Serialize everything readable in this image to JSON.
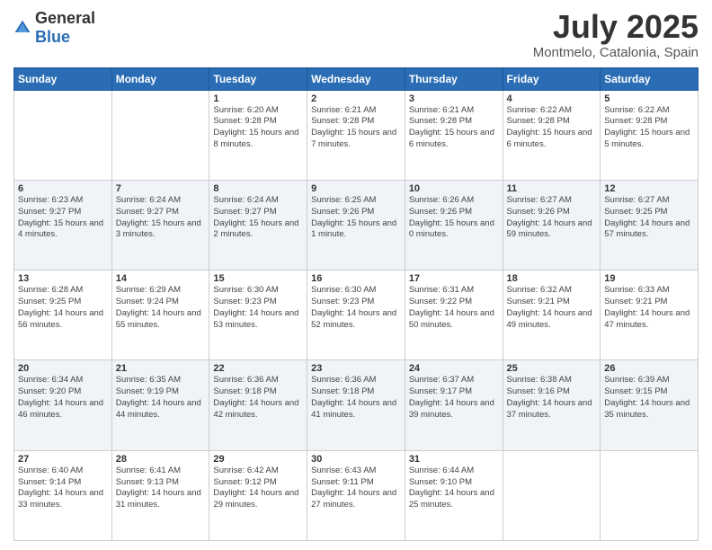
{
  "logo": {
    "general": "General",
    "blue": "Blue"
  },
  "title": {
    "month_year": "July 2025",
    "location": "Montmelo, Catalonia, Spain"
  },
  "weekdays": [
    "Sunday",
    "Monday",
    "Tuesday",
    "Wednesday",
    "Thursday",
    "Friday",
    "Saturday"
  ],
  "weeks": [
    [
      null,
      null,
      {
        "day": 1,
        "sunrise": "6:20 AM",
        "sunset": "9:28 PM",
        "daylight": "15 hours and 8 minutes."
      },
      {
        "day": 2,
        "sunrise": "6:21 AM",
        "sunset": "9:28 PM",
        "daylight": "15 hours and 7 minutes."
      },
      {
        "day": 3,
        "sunrise": "6:21 AM",
        "sunset": "9:28 PM",
        "daylight": "15 hours and 6 minutes."
      },
      {
        "day": 4,
        "sunrise": "6:22 AM",
        "sunset": "9:28 PM",
        "daylight": "15 hours and 6 minutes."
      },
      {
        "day": 5,
        "sunrise": "6:22 AM",
        "sunset": "9:28 PM",
        "daylight": "15 hours and 5 minutes."
      }
    ],
    [
      {
        "day": 6,
        "sunrise": "6:23 AM",
        "sunset": "9:27 PM",
        "daylight": "15 hours and 4 minutes."
      },
      {
        "day": 7,
        "sunrise": "6:24 AM",
        "sunset": "9:27 PM",
        "daylight": "15 hours and 3 minutes."
      },
      {
        "day": 8,
        "sunrise": "6:24 AM",
        "sunset": "9:27 PM",
        "daylight": "15 hours and 2 minutes."
      },
      {
        "day": 9,
        "sunrise": "6:25 AM",
        "sunset": "9:26 PM",
        "daylight": "15 hours and 1 minute."
      },
      {
        "day": 10,
        "sunrise": "6:26 AM",
        "sunset": "9:26 PM",
        "daylight": "15 hours and 0 minutes."
      },
      {
        "day": 11,
        "sunrise": "6:27 AM",
        "sunset": "9:26 PM",
        "daylight": "14 hours and 59 minutes."
      },
      {
        "day": 12,
        "sunrise": "6:27 AM",
        "sunset": "9:25 PM",
        "daylight": "14 hours and 57 minutes."
      }
    ],
    [
      {
        "day": 13,
        "sunrise": "6:28 AM",
        "sunset": "9:25 PM",
        "daylight": "14 hours and 56 minutes."
      },
      {
        "day": 14,
        "sunrise": "6:29 AM",
        "sunset": "9:24 PM",
        "daylight": "14 hours and 55 minutes."
      },
      {
        "day": 15,
        "sunrise": "6:30 AM",
        "sunset": "9:23 PM",
        "daylight": "14 hours and 53 minutes."
      },
      {
        "day": 16,
        "sunrise": "6:30 AM",
        "sunset": "9:23 PM",
        "daylight": "14 hours and 52 minutes."
      },
      {
        "day": 17,
        "sunrise": "6:31 AM",
        "sunset": "9:22 PM",
        "daylight": "14 hours and 50 minutes."
      },
      {
        "day": 18,
        "sunrise": "6:32 AM",
        "sunset": "9:21 PM",
        "daylight": "14 hours and 49 minutes."
      },
      {
        "day": 19,
        "sunrise": "6:33 AM",
        "sunset": "9:21 PM",
        "daylight": "14 hours and 47 minutes."
      }
    ],
    [
      {
        "day": 20,
        "sunrise": "6:34 AM",
        "sunset": "9:20 PM",
        "daylight": "14 hours and 46 minutes."
      },
      {
        "day": 21,
        "sunrise": "6:35 AM",
        "sunset": "9:19 PM",
        "daylight": "14 hours and 44 minutes."
      },
      {
        "day": 22,
        "sunrise": "6:36 AM",
        "sunset": "9:18 PM",
        "daylight": "14 hours and 42 minutes."
      },
      {
        "day": 23,
        "sunrise": "6:36 AM",
        "sunset": "9:18 PM",
        "daylight": "14 hours and 41 minutes."
      },
      {
        "day": 24,
        "sunrise": "6:37 AM",
        "sunset": "9:17 PM",
        "daylight": "14 hours and 39 minutes."
      },
      {
        "day": 25,
        "sunrise": "6:38 AM",
        "sunset": "9:16 PM",
        "daylight": "14 hours and 37 minutes."
      },
      {
        "day": 26,
        "sunrise": "6:39 AM",
        "sunset": "9:15 PM",
        "daylight": "14 hours and 35 minutes."
      }
    ],
    [
      {
        "day": 27,
        "sunrise": "6:40 AM",
        "sunset": "9:14 PM",
        "daylight": "14 hours and 33 minutes."
      },
      {
        "day": 28,
        "sunrise": "6:41 AM",
        "sunset": "9:13 PM",
        "daylight": "14 hours and 31 minutes."
      },
      {
        "day": 29,
        "sunrise": "6:42 AM",
        "sunset": "9:12 PM",
        "daylight": "14 hours and 29 minutes."
      },
      {
        "day": 30,
        "sunrise": "6:43 AM",
        "sunset": "9:11 PM",
        "daylight": "14 hours and 27 minutes."
      },
      {
        "day": 31,
        "sunrise": "6:44 AM",
        "sunset": "9:10 PM",
        "daylight": "14 hours and 25 minutes."
      },
      null,
      null
    ]
  ]
}
